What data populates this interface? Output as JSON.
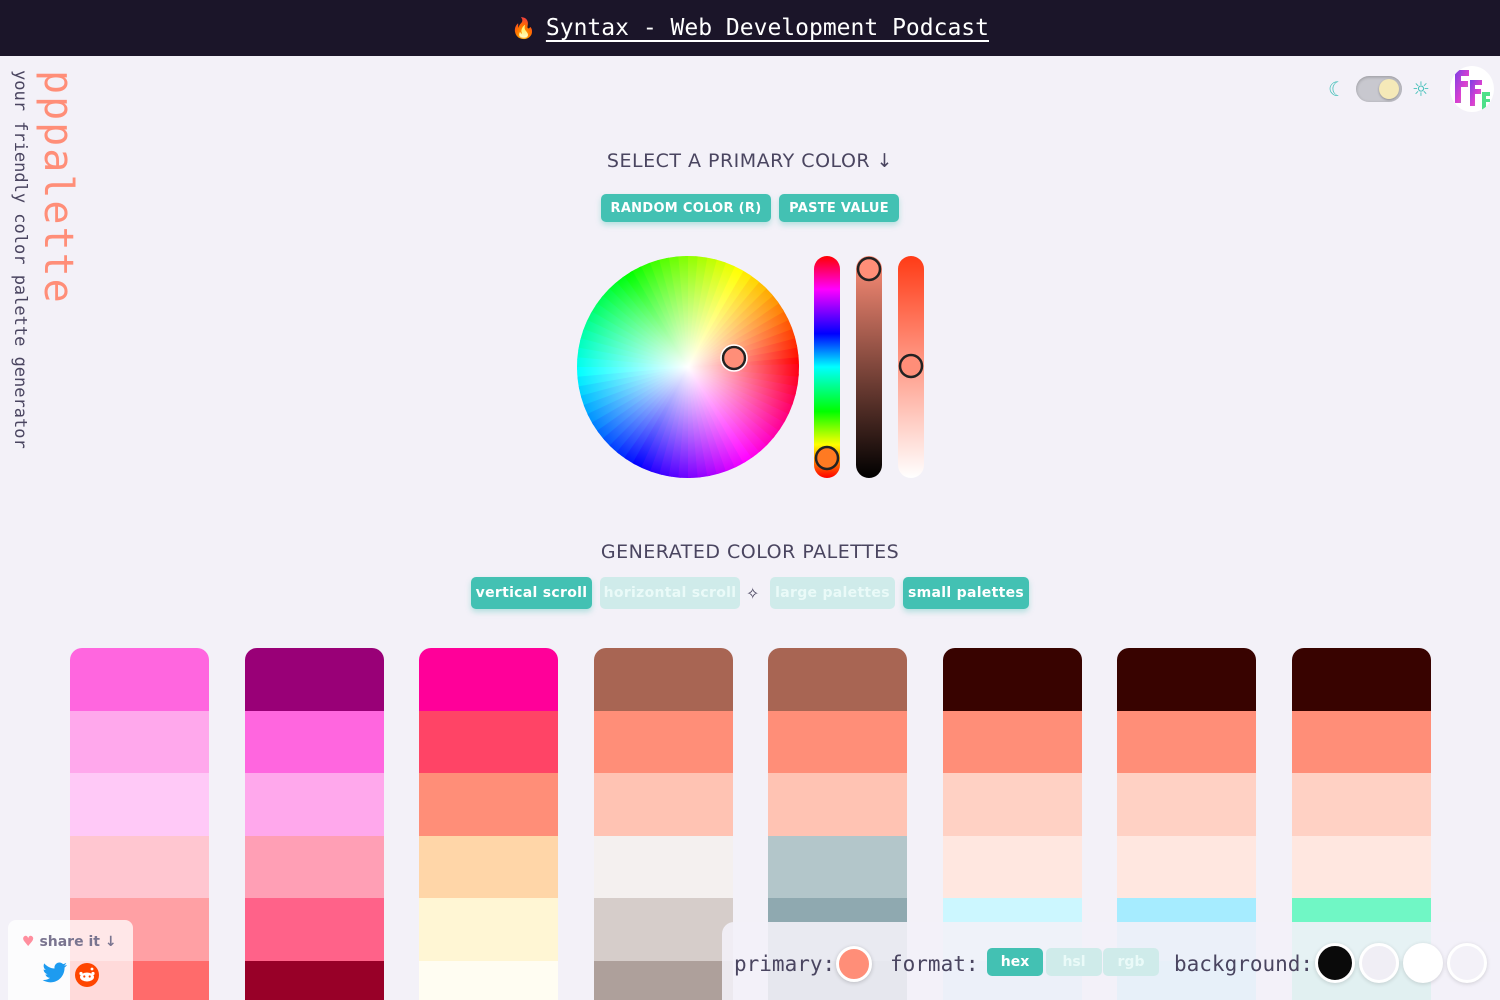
{
  "topbar": {
    "emoji": "🔥",
    "title": "Syntax - Web Development Podcast"
  },
  "brand": {
    "title": "pppalette",
    "subtitle": "your friendly color palette generator",
    "accent": "#ff8e78"
  },
  "theme_toggle": {
    "moon_icon": "moon-icon",
    "sun_icon": "sun-icon",
    "state": "light"
  },
  "picker_section": {
    "heading": "SELECT A PRIMARY COLOR ↓",
    "random_button": "RANDOM COLOR (R)",
    "paste_button": "PASTE VALUE",
    "primary_color": "#ff8e78"
  },
  "palettes_section": {
    "heading": "GENERATED COLOR PALETTES",
    "toggles": [
      {
        "label": "vertical scroll",
        "active": true
      },
      {
        "label": "horizontal scroll",
        "active": false
      },
      {
        "label": "large palettes",
        "active": false
      },
      {
        "label": "small palettes",
        "active": true
      }
    ],
    "sparkle_icon": "sparkle-icon"
  },
  "palettes": [
    [
      "#ff66df",
      "#ffa8ec",
      "#ffc9f7",
      "#ffc6d0",
      "#ffa0a4",
      "#ff6b6b"
    ],
    [
      "#990077",
      "#ff66df",
      "#ffa8ec",
      "#ff9fb5",
      "#ff6289",
      "#980028"
    ],
    [
      "#ff0099",
      "#ff4466",
      "#ff8e78",
      "#ffd6a8",
      "#fff6d4",
      "#fffdf2"
    ],
    [
      "#a86553",
      "#ff8e78",
      "#ffc3b3",
      "#f4f0ef",
      "#d6cdca",
      "#aea09b"
    ],
    [
      "#a86553",
      "#ff8e78",
      "#ffc3b3",
      "#b3c6ca",
      "#8fa9b0",
      "#6d8b92"
    ],
    [
      "#380300",
      "#ff8e78",
      "#ffd1c4",
      "#ffe7e0",
      "#ccf7ff",
      "#a8ecf8"
    ],
    [
      "#380300",
      "#ff8e78",
      "#ffd1c4",
      "#ffe7e0",
      "#a6ecff",
      "#7ee3f7"
    ],
    [
      "#380300",
      "#ff8e78",
      "#ffd1c4",
      "#ffe7e0",
      "#70f7c5",
      "#3ee8ab"
    ]
  ],
  "share": {
    "label": "share it ↓",
    "heart_icon": "heart-icon",
    "twitter_icon": "twitter-icon",
    "reddit_icon": "reddit-icon"
  },
  "controls": {
    "primary_label": "primary:",
    "format_label": "format:",
    "formats": [
      {
        "label": "hex",
        "active": true
      },
      {
        "label": "hsl",
        "active": false
      },
      {
        "label": "rgb",
        "active": false
      }
    ],
    "background_label": "background:",
    "backgrounds": [
      "#0a0a0a",
      "#f0eef5",
      "#ffffff",
      "#f3f1f8"
    ]
  }
}
